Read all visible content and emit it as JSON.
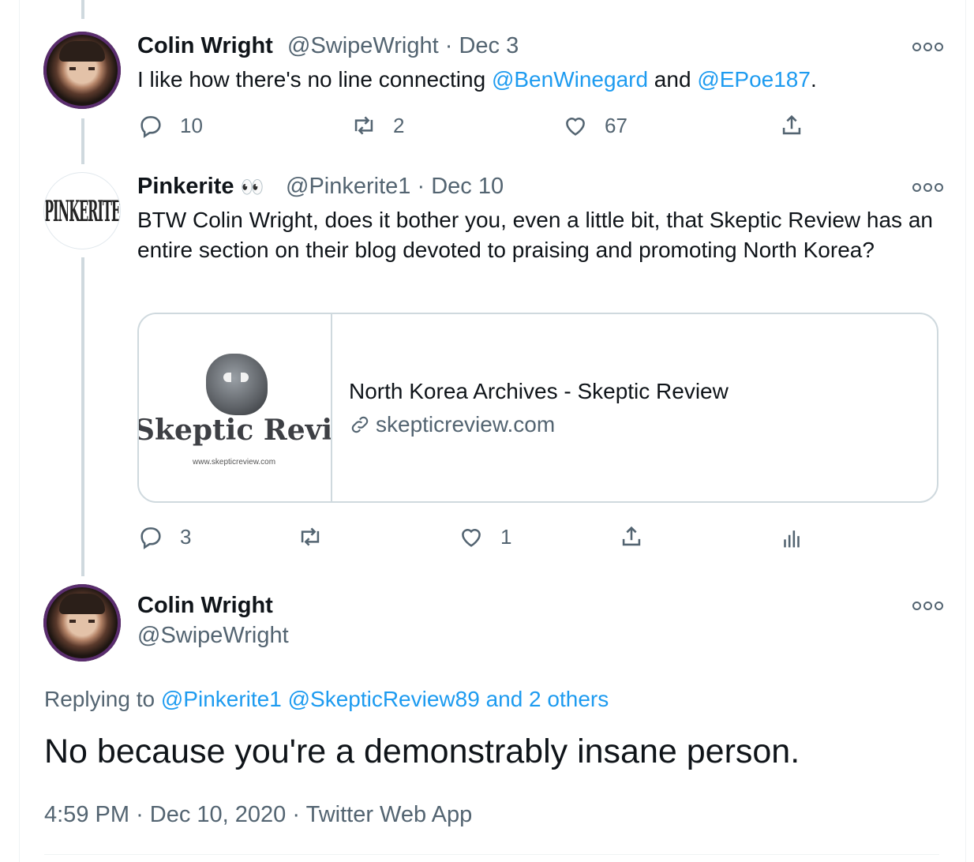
{
  "tweet1": {
    "name": "Colin Wright",
    "handle": "@SwipeWright",
    "sep": "·",
    "date": "Dec 3",
    "text_prefix": "I like how there's no line connecting ",
    "mention1": "@BenWinegard",
    "text_mid": " and ",
    "mention2": "@EPoe187",
    "text_suffix": ".",
    "replies": "10",
    "retweets": "2",
    "likes": "67"
  },
  "tweet2": {
    "name": "Pinkerite",
    "emoji": "👀",
    "handle": "@Pinkerite1",
    "sep": "·",
    "date": "Dec 10",
    "avatar_text": "PINKERITE",
    "text": "BTW Colin Wright, does it bother you, even a little bit, that Skeptic Review has an entire section on their blog devoted to praising and promoting North Korea?",
    "card": {
      "image_brand": "Skeptic Review",
      "image_url": "www.skepticreview.com",
      "title": "North Korea Archives - Skeptic Review",
      "domain": "skepticreview.com"
    },
    "replies": "3",
    "retweets": "",
    "likes": "1"
  },
  "main": {
    "name": "Colin Wright",
    "handle": "@SwipeWright",
    "replying_label": "Replying to ",
    "replying_mentions": "@Pinkerite1 @SkepticReview89 and 2 others",
    "text": "No because you're a demonstrably insane person.",
    "time": "4:59 PM",
    "sep": "·",
    "date": "Dec 10, 2020",
    "source": "Twitter Web App"
  },
  "colors": {
    "accent": "#1d9bf0",
    "muted": "#536471",
    "text": "#0f1419",
    "line": "#cfd9de"
  }
}
